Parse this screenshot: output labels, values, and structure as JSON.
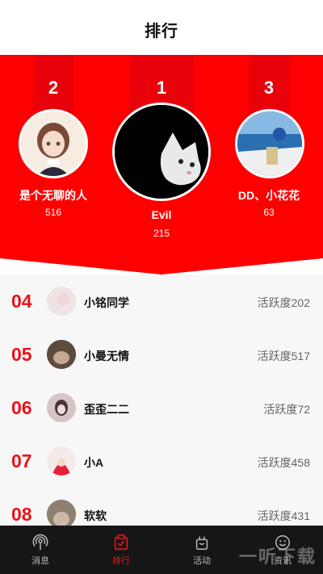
{
  "header": {
    "title": "排行"
  },
  "podium": [
    {
      "rank": "2",
      "name": "是个无聊的人",
      "score": "516",
      "avatar": "anime-girl"
    },
    {
      "rank": "1",
      "name": "Evil",
      "score": "215",
      "avatar": "white-cat"
    },
    {
      "rank": "3",
      "name": "DD、小花花",
      "score": "63",
      "avatar": "santorini"
    }
  ],
  "list": [
    {
      "rank": "04",
      "name": "小铭同学",
      "activity": "活跃度202"
    },
    {
      "rank": "05",
      "name": "小曼无情",
      "activity": "活跃度517"
    },
    {
      "rank": "06",
      "name": "歪歪二二",
      "activity": "活跃度72"
    },
    {
      "rank": "07",
      "name": "小A",
      "activity": "活跃度458"
    },
    {
      "rank": "08",
      "name": "软软",
      "activity": "活跃度431"
    }
  ],
  "tabbar": {
    "items": [
      {
        "label": "消息",
        "icon": "broadcast-icon",
        "active": false
      },
      {
        "label": "排行",
        "icon": "rank-icon",
        "active": true
      },
      {
        "label": "活动",
        "icon": "bag-icon",
        "active": false
      },
      {
        "label": "资讯",
        "icon": "smile-icon",
        "active": false
      }
    ]
  },
  "watermark": "一听下载",
  "colors": {
    "primary": "#ff0000",
    "rank_text": "#e8141a",
    "tabbar_bg": "#161616"
  }
}
